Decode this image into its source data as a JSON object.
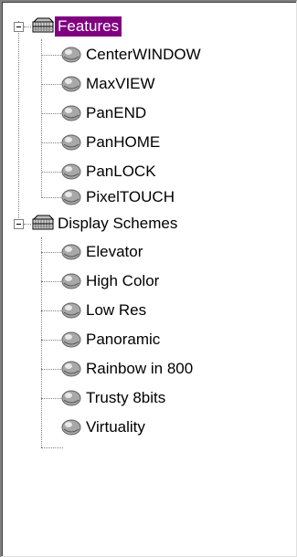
{
  "tree": {
    "groups": [
      {
        "label": "Features",
        "selected": true,
        "expanded": true,
        "icon": "gear-rack-icon",
        "items": [
          {
            "label": "CenterWINDOW",
            "icon": "gem-icon"
          },
          {
            "label": "MaxVIEW",
            "icon": "gem-icon"
          },
          {
            "label": "PanEND",
            "icon": "gem-icon"
          },
          {
            "label": "PanHOME",
            "icon": "gem-icon"
          },
          {
            "label": "PanLOCK",
            "icon": "gem-icon"
          },
          {
            "label": "PixelTOUCH",
            "icon": "gem-icon"
          }
        ]
      },
      {
        "label": "Display Schemes",
        "selected": false,
        "expanded": true,
        "icon": "gear-rack-icon",
        "items": [
          {
            "label": "Elevator",
            "icon": "gem-icon"
          },
          {
            "label": "High Color",
            "icon": "gem-icon"
          },
          {
            "label": "Low Res",
            "icon": "gem-icon"
          },
          {
            "label": "Panoramic",
            "icon": "gem-icon"
          },
          {
            "label": "Rainbow in 800",
            "icon": "gem-icon"
          },
          {
            "label": "Trusty 8bits",
            "icon": "gem-icon"
          },
          {
            "label": "Virtuality",
            "icon": "gem-icon"
          }
        ]
      }
    ],
    "colors": {
      "selection_bg": "#800080",
      "selection_fg": "#ffffff",
      "tree_lines": "#808080"
    }
  }
}
